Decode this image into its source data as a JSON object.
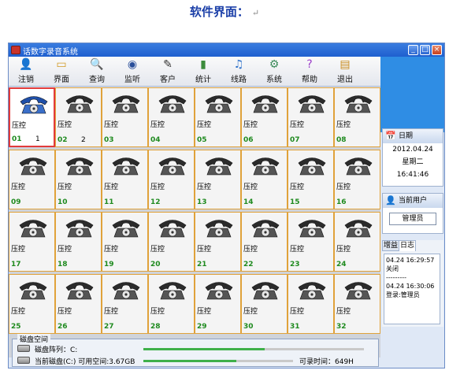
{
  "heading": {
    "text": "软件界面：",
    "para_mark": "↵"
  },
  "window": {
    "title": "话数字录音系统"
  },
  "toolbar": [
    {
      "label": "注销",
      "icon": "logout-icon",
      "glyph": "👤",
      "color": "#c04a1a"
    },
    {
      "label": "界面",
      "icon": "layout-icon",
      "glyph": "▭",
      "color": "#d19a22"
    },
    {
      "label": "查询",
      "icon": "search-icon",
      "glyph": "🔍",
      "color": "#4a6a8a"
    },
    {
      "label": "监听",
      "icon": "listen-icon",
      "glyph": "◉",
      "color": "#2a4f9a"
    },
    {
      "label": "客户",
      "icon": "customer-icon",
      "glyph": "✎",
      "color": "#333333"
    },
    {
      "label": "统计",
      "icon": "stats-icon",
      "glyph": "▮",
      "color": "#3c8c3c"
    },
    {
      "label": "线路",
      "icon": "line-icon",
      "glyph": "♫",
      "color": "#2a6fc9"
    },
    {
      "label": "系统",
      "icon": "system-icon",
      "glyph": "⚙",
      "color": "#3a8a5a"
    },
    {
      "label": "帮助",
      "icon": "help-icon",
      "glyph": "?",
      "color": "#9b3fc9"
    },
    {
      "label": "退出",
      "icon": "exit-icon",
      "glyph": "▤",
      "color": "#c78a1a"
    }
  ],
  "channels": [
    {
      "label": "压控",
      "num": "01",
      "idx": "1",
      "selected": true
    },
    {
      "label": "压控",
      "num": "02",
      "idx": "2"
    },
    {
      "label": "压控",
      "num": "03"
    },
    {
      "label": "压控",
      "num": "04"
    },
    {
      "label": "压控",
      "num": "05"
    },
    {
      "label": "压控",
      "num": "06"
    },
    {
      "label": "压控",
      "num": "07"
    },
    {
      "label": "压控",
      "num": "08"
    },
    {
      "label": "压控",
      "num": "09"
    },
    {
      "label": "压控",
      "num": "10"
    },
    {
      "label": "压控",
      "num": "11"
    },
    {
      "label": "压控",
      "num": "12"
    },
    {
      "label": "压控",
      "num": "13"
    },
    {
      "label": "压控",
      "num": "14"
    },
    {
      "label": "压控",
      "num": "15"
    },
    {
      "label": "压控",
      "num": "16"
    },
    {
      "label": "压控",
      "num": "17"
    },
    {
      "label": "压控",
      "num": "18"
    },
    {
      "label": "压控",
      "num": "19"
    },
    {
      "label": "压控",
      "num": "20"
    },
    {
      "label": "压控",
      "num": "21"
    },
    {
      "label": "压控",
      "num": "22"
    },
    {
      "label": "压控",
      "num": "23"
    },
    {
      "label": "压控",
      "num": "24"
    },
    {
      "label": "压控",
      "num": "25"
    },
    {
      "label": "压控",
      "num": "26"
    },
    {
      "label": "压控",
      "num": "27"
    },
    {
      "label": "压控",
      "num": "28"
    },
    {
      "label": "压控",
      "num": "29"
    },
    {
      "label": "压控",
      "num": "30"
    },
    {
      "label": "压控",
      "num": "31"
    },
    {
      "label": "压控",
      "num": "32"
    }
  ],
  "disk": {
    "legend": "磁盘空间",
    "array_label": "磁盘阵列：C:",
    "current_label": "当前磁盘(C:) 可用空间:3.67GB",
    "record_time": "可录时间：649H",
    "array_fill": 0.55,
    "current_fill": 0.62
  },
  "side": {
    "date_title": "日期",
    "date": "2012.04.24",
    "weekday": "星期二",
    "time": "16:41:46",
    "user_title": "当前用户",
    "user": "管理员",
    "tabs": [
      "增益",
      "日志"
    ],
    "log": [
      "04.24 16:29:57",
      "关闭",
      "---------",
      "04.24 16:30:06",
      "登录:管理员"
    ]
  }
}
